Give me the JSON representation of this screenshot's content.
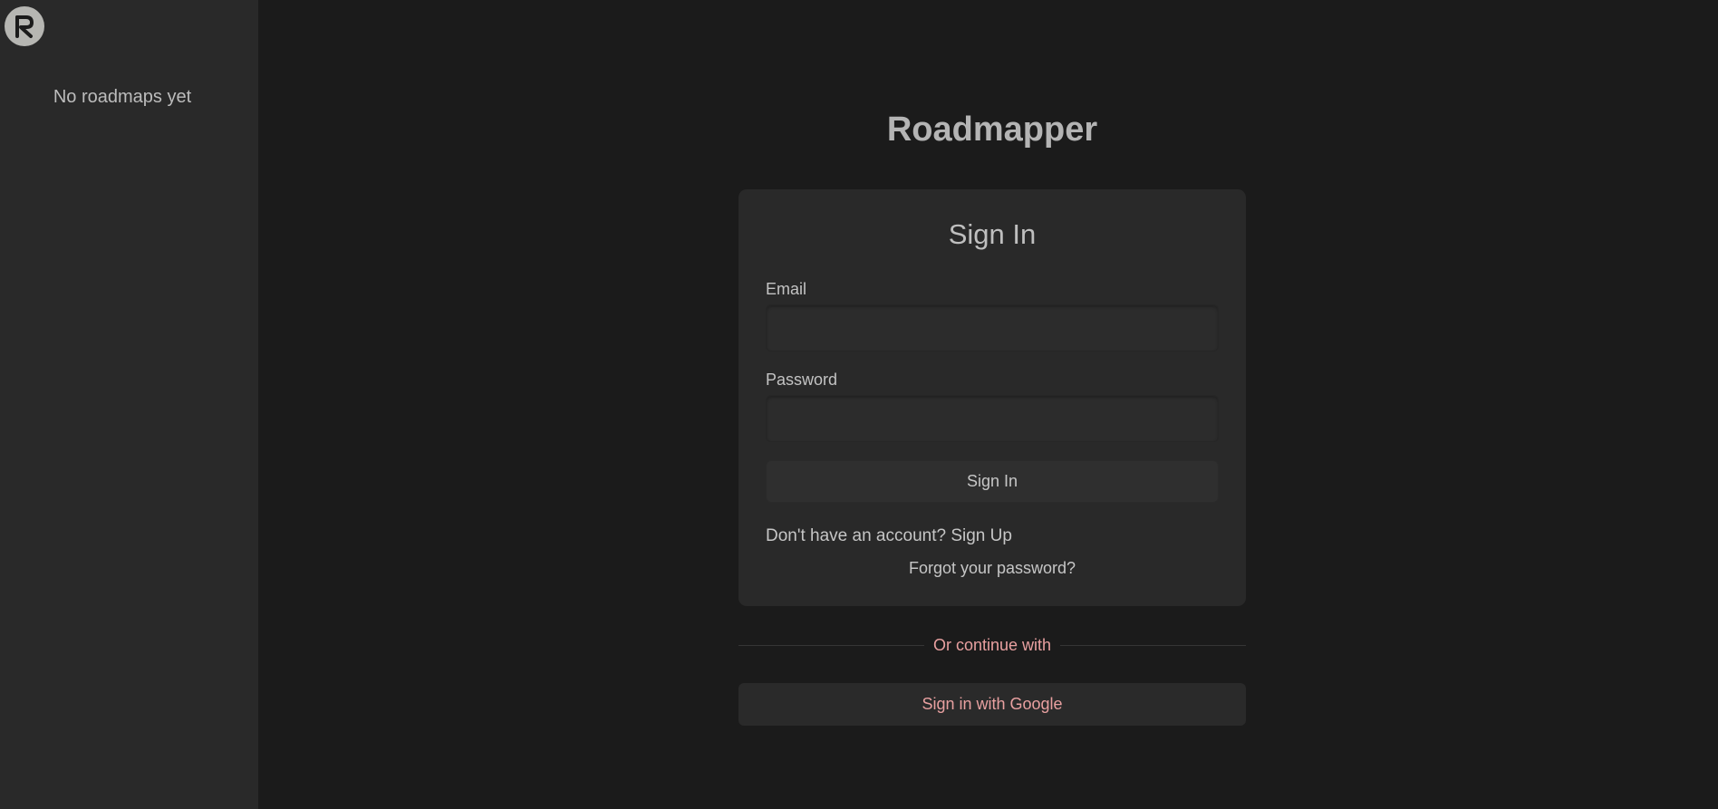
{
  "sidebar": {
    "logo_letter": "R",
    "empty_text": "No roadmaps yet"
  },
  "main": {
    "app_title": "Roadmapper",
    "card": {
      "title": "Sign In",
      "email_label": "Email",
      "email_value": "",
      "password_label": "Password",
      "password_value": "",
      "submit_label": "Sign In",
      "signup_prompt": "Don't have an account?",
      "signup_link": "Sign Up",
      "forgot_link": "Forgot your password?"
    },
    "divider_text": "Or continue with",
    "google_label": "Sign in with Google"
  },
  "colors": {
    "background": "#1b1b1b",
    "sidebar": "#292929",
    "card": "#292929",
    "accent_text": "#e8a0a0"
  }
}
